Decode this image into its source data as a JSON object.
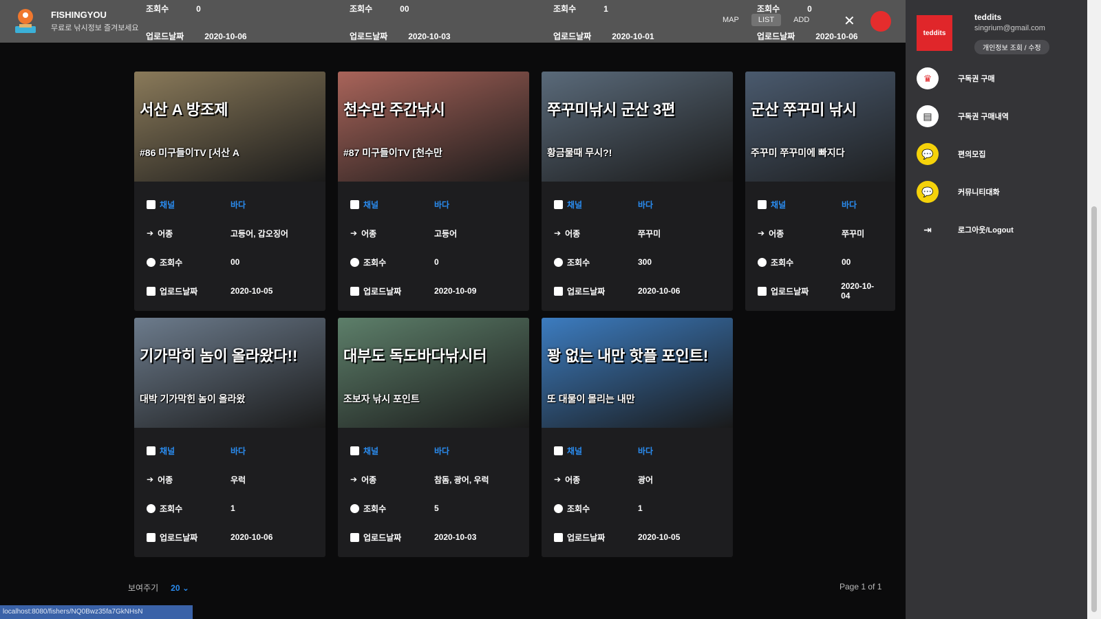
{
  "header": {
    "brand": "FISHINGYOU",
    "subtitle": "무료로 낚시정보 즐겨보세요",
    "tabs": [
      "MAP",
      "LIST",
      "ADD"
    ],
    "active_tab": "LIST"
  },
  "labels": {
    "channel": "채널",
    "fish": "어종",
    "views": "조회수",
    "uploaded": "업로드날짜"
  },
  "top_partial_rows": [
    {
      "views": "0",
      "date": "2020-10-06"
    },
    {
      "views": "00",
      "date": "2020-10-03"
    },
    {
      "views": "1",
      "date": "2020-10-01"
    },
    {
      "views": "0",
      "date": "2020-10-06"
    }
  ],
  "cards": [
    {
      "cap1": "서산 A 방조제",
      "cap2": "#86 미구들이TV [서산 A",
      "channel": "바다",
      "fish": "고등어, 갑오징어",
      "views": "00",
      "date": "2020-10-05",
      "bg": "#8a7a5a"
    },
    {
      "cap1": "천수만 주간낚시",
      "cap2": "#87 미구들이TV [천수만",
      "channel": "바다",
      "fish": "고등어",
      "views": "0",
      "date": "2020-10-09",
      "bg": "#a9645a"
    },
    {
      "cap1": "쭈꾸미낚시 군산 3편",
      "cap2": "황금물때 무시?!",
      "channel": "바다",
      "fish": "쭈꾸미",
      "views": "300",
      "date": "2020-10-06",
      "bg": "#5a6a7a"
    },
    {
      "cap1": "군산 쭈꾸미 낚시",
      "cap2": "주꾸미 쭈꾸미에 빠지다",
      "channel": "바다",
      "fish": "쭈꾸미",
      "views": "00",
      "date": "2020-10-04",
      "bg": "#4a5a6e"
    },
    {
      "cap1": "기가막히 놈이 올라왔다!!",
      "cap2": "대박 기가막힌 놈이 올라왔",
      "channel": "바다",
      "fish": "우럭",
      "views": "1",
      "date": "2020-10-06",
      "bg": "#6c7b8c"
    },
    {
      "cap1": "대부도 독도바다낚시터",
      "cap2": "조보자 낚시 포인트",
      "channel": "바다",
      "fish": "참돔, 광어, 우럭",
      "views": "5",
      "date": "2020-10-03",
      "bg": "#5d7f6a"
    },
    {
      "cap1": "꽝 없는 내만 핫플 포인트!",
      "cap2": "또 대물이 몰리는 내만",
      "channel": "바다",
      "fish": "광어",
      "views": "1",
      "date": "2020-10-05",
      "bg": "#3c7cc0"
    }
  ],
  "footer": {
    "per_page_label": "보여주기",
    "per_page_value": "20",
    "page_text": "Page 1 of 1"
  },
  "status_url": "localhost:8080/fishers/NQ0Bwz35fa7GkNHsN",
  "drawer": {
    "logo_text": "teddits",
    "username": "teddits",
    "email": "singrium@gmail.com",
    "edit_label": "개인정보 조회 / 수정",
    "menu": [
      {
        "label": "구독권 구매",
        "icon": "crown-icon",
        "color": "#ffffff"
      },
      {
        "label": "구독권 구매내역",
        "icon": "receipt-icon",
        "color": "#ffffff"
      },
      {
        "label": "편의모집",
        "icon": "chat-icon",
        "color": "#f5d20a"
      },
      {
        "label": "커뮤니티대화",
        "icon": "talk-icon",
        "color": "#f5d20a"
      },
      {
        "label": "로그아웃/Logout",
        "icon": "logout-icon",
        "color": "transparent"
      }
    ]
  }
}
